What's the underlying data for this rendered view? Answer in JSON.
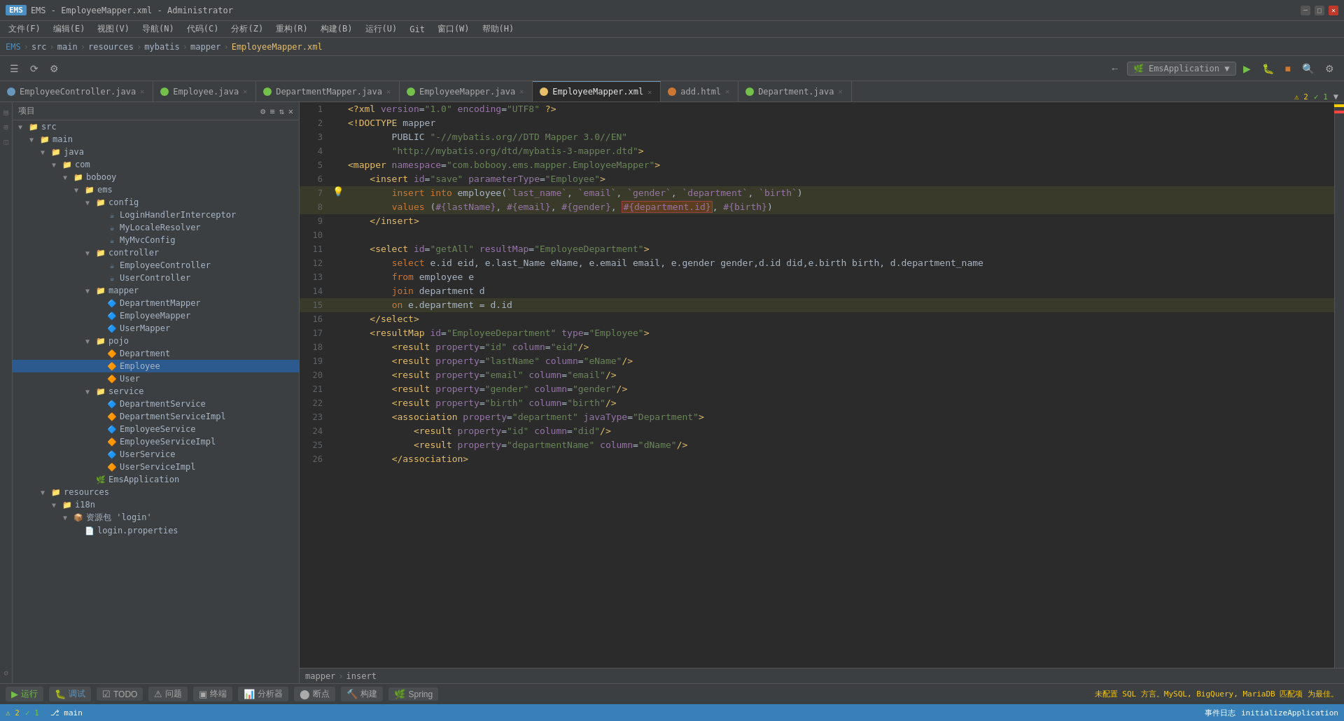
{
  "titleBar": {
    "title": "EMS - EmployeeMapper.xml - Administrator",
    "icon": "EMS"
  },
  "menuBar": {
    "items": [
      "文件(F)",
      "编辑(E)",
      "视图(V)",
      "导航(N)",
      "代码(C)",
      "分析(Z)",
      "重构(R)",
      "构建(B)",
      "运行(U)",
      "Git",
      "窗口(W)",
      "帮助(H)"
    ]
  },
  "breadcrumb": {
    "parts": [
      "EMS",
      "src",
      "main",
      "resources",
      "mybatis",
      "mapper",
      "EmployeeMapper.xml"
    ]
  },
  "tabs": [
    {
      "label": "EmployeeController.java",
      "type": "java",
      "active": false
    },
    {
      "label": "Employee.java",
      "type": "java-green",
      "active": false
    },
    {
      "label": "DepartmentMapper.java",
      "type": "java-green",
      "active": false
    },
    {
      "label": "EmployeeMapper.java",
      "type": "java-green",
      "active": false
    },
    {
      "label": "EmployeeMapper.xml",
      "type": "xml",
      "active": true
    },
    {
      "label": "add.html",
      "type": "html",
      "active": false
    },
    {
      "label": "Department.java",
      "type": "java-green",
      "active": false
    }
  ],
  "sidebar": {
    "header": "项目",
    "tree": [
      {
        "indent": 0,
        "type": "folder",
        "label": "src",
        "expanded": true
      },
      {
        "indent": 1,
        "type": "folder",
        "label": "main",
        "expanded": true
      },
      {
        "indent": 2,
        "type": "folder",
        "label": "java",
        "expanded": true
      },
      {
        "indent": 3,
        "type": "folder",
        "label": "com",
        "expanded": true
      },
      {
        "indent": 4,
        "type": "folder",
        "label": "bobooy",
        "expanded": true
      },
      {
        "indent": 5,
        "type": "folder",
        "label": "ems",
        "expanded": true
      },
      {
        "indent": 6,
        "type": "folder",
        "label": "config",
        "expanded": true
      },
      {
        "indent": 7,
        "type": "java",
        "label": "LoginHandlerInterceptor"
      },
      {
        "indent": 7,
        "type": "java",
        "label": "MyLocaleResolver"
      },
      {
        "indent": 7,
        "type": "java",
        "label": "MyMvcConfig"
      },
      {
        "indent": 6,
        "type": "folder",
        "label": "controller",
        "expanded": true
      },
      {
        "indent": 7,
        "type": "java",
        "label": "EmployeeController"
      },
      {
        "indent": 7,
        "type": "java",
        "label": "UserController"
      },
      {
        "indent": 6,
        "type": "folder",
        "label": "mapper",
        "expanded": true
      },
      {
        "indent": 7,
        "type": "java-i",
        "label": "DepartmentMapper"
      },
      {
        "indent": 7,
        "type": "java-i",
        "label": "EmployeeMapper"
      },
      {
        "indent": 7,
        "type": "java-i",
        "label": "UserMapper"
      },
      {
        "indent": 6,
        "type": "folder",
        "label": "pojo",
        "expanded": true
      },
      {
        "indent": 7,
        "type": "java-c",
        "label": "Department"
      },
      {
        "indent": 7,
        "type": "java-c",
        "label": "Employee",
        "selected": true
      },
      {
        "indent": 7,
        "type": "java-c",
        "label": "User"
      },
      {
        "indent": 6,
        "type": "folder",
        "label": "service",
        "expanded": true
      },
      {
        "indent": 7,
        "type": "java-i",
        "label": "DepartmentService"
      },
      {
        "indent": 7,
        "type": "java-c",
        "label": "DepartmentServiceImpl"
      },
      {
        "indent": 7,
        "type": "java-i",
        "label": "EmployeeService"
      },
      {
        "indent": 7,
        "type": "java-c",
        "label": "EmployeeServiceImpl"
      },
      {
        "indent": 7,
        "type": "java-i",
        "label": "UserService"
      },
      {
        "indent": 7,
        "type": "java-c",
        "label": "UserServiceImpl"
      },
      {
        "indent": 6,
        "type": "java-spring",
        "label": "EmsApplication"
      },
      {
        "indent": 2,
        "type": "folder",
        "label": "resources",
        "expanded": true
      },
      {
        "indent": 3,
        "type": "folder",
        "label": "i18n",
        "expanded": true
      },
      {
        "indent": 4,
        "type": "folder",
        "label": "资源包 'login'",
        "expanded": true
      },
      {
        "indent": 5,
        "type": "props",
        "label": "login.properties"
      }
    ]
  },
  "editor": {
    "filename": "EmployeeMapper.xml",
    "lines": [
      {
        "num": 1,
        "content": "<?xml version=\"1.0\" encoding=\"UTF8\" ?>"
      },
      {
        "num": 2,
        "content": "<!DOCTYPE mapper"
      },
      {
        "num": 3,
        "content": "        PUBLIC \"-//mybatis.org//DTD Mapper 3.0//EN\""
      },
      {
        "num": 4,
        "content": "        \"http://mybatis.org/dtd/mybatis-3-mapper.dtd\">"
      },
      {
        "num": 5,
        "content": "<mapper namespace=\"com.bobooy.ems.mapper.EmployeeMapper\">"
      },
      {
        "num": 6,
        "content": "    <insert id=\"save\" parameterType=\"Employee\">"
      },
      {
        "num": 7,
        "content": "        insert into employee(`last_name`, `email`, `gender`, `department`, `birth`)",
        "highlight": true,
        "bulb": true
      },
      {
        "num": 8,
        "content": "        values (#{lastName}, #{email}, #{gender}, #{department.id}, #{birth})",
        "highlight": true,
        "box": "#{department.id}"
      },
      {
        "num": 9,
        "content": "    </insert>"
      },
      {
        "num": 10,
        "content": ""
      },
      {
        "num": 11,
        "content": "    <select id=\"getAll\" resultMap=\"EmployeeDepartment\">"
      },
      {
        "num": 12,
        "content": "        select e.id eid, e.last_Name eName, e.email email, e.gender gender,d.id did,e.birth birth, d.department_name"
      },
      {
        "num": 13,
        "content": "        from employee e"
      },
      {
        "num": 14,
        "content": "        join department d"
      },
      {
        "num": 15,
        "content": "        on e.department = d.id",
        "highlight": true
      },
      {
        "num": 16,
        "content": "    </select>"
      },
      {
        "num": 17,
        "content": "    <resultMap id=\"EmployeeDepartment\" type=\"Employee\">"
      },
      {
        "num": 18,
        "content": "        <result property=\"id\" column=\"eid\"/>"
      },
      {
        "num": 19,
        "content": "        <result property=\"lastName\" column=\"eName\"/>"
      },
      {
        "num": 20,
        "content": "        <result property=\"email\" column=\"email\"/>"
      },
      {
        "num": 21,
        "content": "        <result property=\"gender\" column=\"gender\"/>"
      },
      {
        "num": 22,
        "content": "        <result property=\"birth\" column=\"birth\"/>"
      },
      {
        "num": 23,
        "content": "        <association property=\"department\" javaType=\"Department\">"
      },
      {
        "num": 24,
        "content": "            <result property=\"id\" column=\"did\"/>"
      },
      {
        "num": 25,
        "content": "            <result property=\"departmentName\" column=\"dName\"/>"
      },
      {
        "num": 26,
        "content": "        </association>"
      }
    ],
    "bottomBreadcrumb": [
      "mapper",
      "insert"
    ]
  },
  "bottomBar": {
    "buttons": [
      {
        "label": "运行",
        "icon": "▶",
        "type": "run"
      },
      {
        "label": "调试",
        "icon": "🐛",
        "type": "debug"
      },
      {
        "label": "TODO",
        "icon": "☑",
        "type": "todo"
      },
      {
        "label": "问题",
        "icon": "⚠",
        "type": "issues"
      },
      {
        "label": "终端",
        "icon": "▣",
        "type": "terminal"
      },
      {
        "label": "分析器",
        "icon": "📊",
        "type": "profiler"
      },
      {
        "label": "断点",
        "icon": "⬤",
        "type": "breakpoints"
      },
      {
        "label": "构建",
        "icon": "🔨",
        "type": "build"
      },
      {
        "label": "Spring",
        "icon": "🌿",
        "type": "spring"
      }
    ],
    "runConfig": "EmsApplication",
    "statusText": "未配置 SQL 方言。MySQL, BigQuery, MariaDB 匹配项 为最佳。"
  },
  "statusBar": {
    "left": [
      "⚠ 2",
      "✓ 1"
    ],
    "right": [
      "事件日志",
      "initializeApplication"
    ]
  }
}
